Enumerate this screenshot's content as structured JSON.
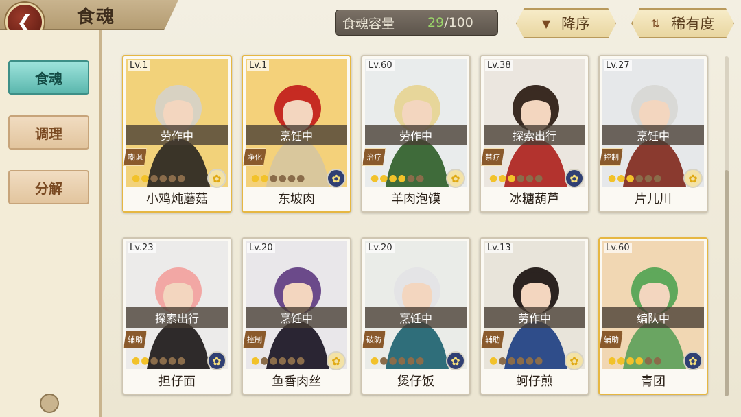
{
  "header": {
    "title": "食魂",
    "capacity_label": "食魂容量",
    "capacity_current": "29",
    "capacity_sep": "/",
    "capacity_max": "100",
    "sort_label": "降序",
    "rarity_label": "稀有度"
  },
  "sidebar": {
    "items": [
      {
        "label": "食魂"
      },
      {
        "label": "调理"
      },
      {
        "label": "分解"
      }
    ]
  },
  "cards": [
    {
      "level": "Lv.1",
      "status": "劳作中",
      "role": "嘲讽",
      "name": "小鸡炖蘑菇",
      "stars_on": 2,
      "stars_total": 6,
      "element": "flower-icon",
      "frame": "gold",
      "bg": "#f2d27a",
      "hair": "#d8d2c2",
      "coat": "#3a3428"
    },
    {
      "level": "Lv.1",
      "status": "烹饪中",
      "role": "净化",
      "name": "东坡肉",
      "stars_on": 2,
      "stars_total": 6,
      "element": "flower-icon",
      "frame": "gold",
      "bg": "#f4d17a",
      "hair": "#c62b22",
      "coat": "#d9c79c"
    },
    {
      "level": "Lv.60",
      "status": "劳作中",
      "role": "治疗",
      "name": "羊肉泡馍",
      "stars_on": 4,
      "stars_total": 6,
      "element": "flower-icon",
      "frame": "normal",
      "bg": "#e9ecec",
      "hair": "#e7d69a",
      "coat": "#3f6b3a"
    },
    {
      "level": "Lv.38",
      "status": "探索出行",
      "role": "禁疗",
      "name": "冰糖葫芦",
      "stars_on": 3,
      "stars_total": 6,
      "element": "flower-icon",
      "frame": "normal",
      "bg": "#ebe6df",
      "hair": "#3a2b22",
      "coat": "#b3332e"
    },
    {
      "level": "Lv.27",
      "status": "烹饪中",
      "role": "控制",
      "name": "片儿川",
      "stars_on": 3,
      "stars_total": 6,
      "element": "flower-icon",
      "frame": "normal",
      "bg": "#e6e8ea",
      "hair": "#d9d9d6",
      "coat": "#8a3a2f"
    },
    {
      "level": "Lv.23",
      "status": "探索出行",
      "role": "辅助",
      "name": "担仔面",
      "stars_on": 2,
      "stars_total": 6,
      "element": "flower-icon",
      "frame": "normal",
      "bg": "#ecebea",
      "hair": "#f2a7a4",
      "coat": "#2e2a2a"
    },
    {
      "level": "Lv.20",
      "status": "烹饪中",
      "role": "控制",
      "name": "鱼香肉丝",
      "stars_on": 1,
      "stars_total": 6,
      "element": "flower-icon",
      "frame": "normal",
      "bg": "#e9e7ea",
      "hair": "#6b4a8a",
      "coat": "#2a2533"
    },
    {
      "level": "Lv.20",
      "status": "烹饪中",
      "role": "破防",
      "name": "煲仔饭",
      "stars_on": 1,
      "stars_total": 6,
      "element": "flower-icon",
      "frame": "normal",
      "bg": "#eaece8",
      "hair": "#e4e4e6",
      "coat": "#2f6e7a"
    },
    {
      "level": "Lv.13",
      "status": "劳作中",
      "role": "辅助",
      "name": "蚵仔煎",
      "stars_on": 1,
      "stars_total": 6,
      "element": "flower-icon",
      "frame": "normal",
      "bg": "#e8e4da",
      "hair": "#2b2320",
      "coat": "#2f4d8a"
    },
    {
      "level": "Lv.60",
      "status": "编队中",
      "role": "辅助",
      "name": "青团",
      "stars_on": 4,
      "stars_total": 6,
      "element": "flower-icon",
      "frame": "gold",
      "bg": "#f1d7b3",
      "hair": "#5fa85b",
      "coat": "#6aa562"
    }
  ]
}
